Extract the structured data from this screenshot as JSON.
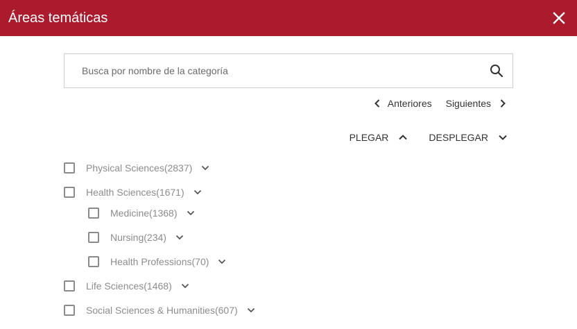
{
  "header": {
    "title": "Áreas temáticas"
  },
  "search": {
    "placeholder": "Busca por nombre de la categoría",
    "value": ""
  },
  "pager": {
    "previous": "Anteriores",
    "next": "Siguientes"
  },
  "fold": {
    "collapse": "PLEGAR",
    "expand": "DESPLEGAR"
  },
  "tree": {
    "physical": "Physical Sciences(2837)",
    "health": "Health Sciences(1671)",
    "medicine": "Medicine(1368)",
    "nursing": "Nursing(234)",
    "professions": "Health Professions(70)",
    "life": "Life Sciences(1468)",
    "social": "Social Sciences & Humanities(607)"
  },
  "colors": {
    "header_bg": "#ab1a2d",
    "text_muted": "#8c8c8c"
  }
}
